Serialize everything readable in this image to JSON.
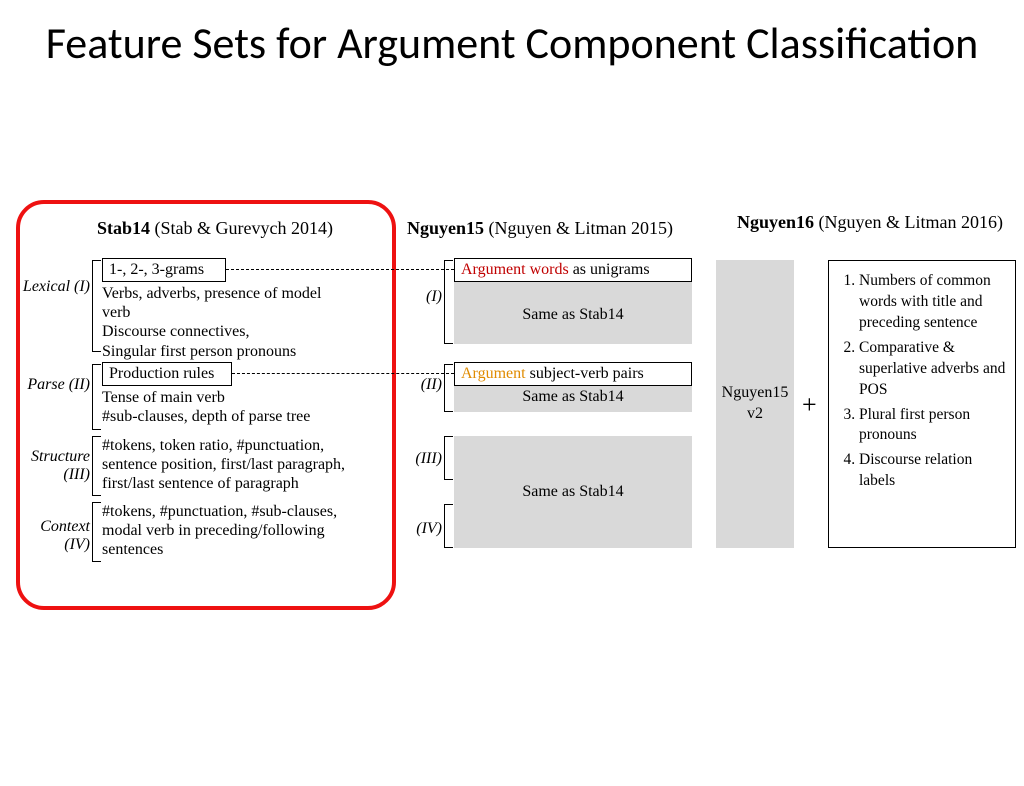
{
  "title": "Feature Sets for Argument Component Classification",
  "columns": {
    "stab14": {
      "bold": "Stab14",
      "rest": " (Stab & Gurevych 2014)"
    },
    "nguyen15": {
      "bold": "Nguyen15",
      "rest": " (Nguyen & Litman 2015)"
    },
    "nguyen16": {
      "bold": "Nguyen16",
      "rest": " (Nguyen & Litman 2016)"
    }
  },
  "stab14": {
    "labels": {
      "lexical": "Lexical (I)",
      "parse": "Parse (II)",
      "structure": "Structure (III)",
      "context": "Context (IV)"
    },
    "lexical_box": "1-, 2-, 3-grams",
    "lexical_body": "Verbs, adverbs, presence of model verb\nDiscourse connectives,\nSingular first person pronouns",
    "parse_box": "Production rules",
    "parse_body": "Tense of main verb\n#sub-clauses, depth of parse tree",
    "structure_body": "#tokens, token ratio, #punctuation, sentence position, first/last paragraph, first/last sentence of paragraph",
    "context_body": "#tokens, #punctuation, #sub-clauses, modal verb in preceding/following sentences"
  },
  "nguyen15": {
    "labels": {
      "i": "(I)",
      "ii": "(II)",
      "iii": "(III)",
      "iv": "(IV)"
    },
    "box1_highlight": "Argument words",
    "box1_rest": " as unigrams",
    "box2_highlight": "Argument",
    "box2_rest": " subject-verb pairs",
    "same": "Same as Stab14"
  },
  "nguyen16": {
    "v2": "Nguyen15 v2",
    "plus": "+",
    "items": [
      "Numbers of common words with title and preceding sentence",
      "Comparative & superlative adverbs and POS",
      "Plural first person pronouns",
      "Discourse relation labels"
    ]
  }
}
